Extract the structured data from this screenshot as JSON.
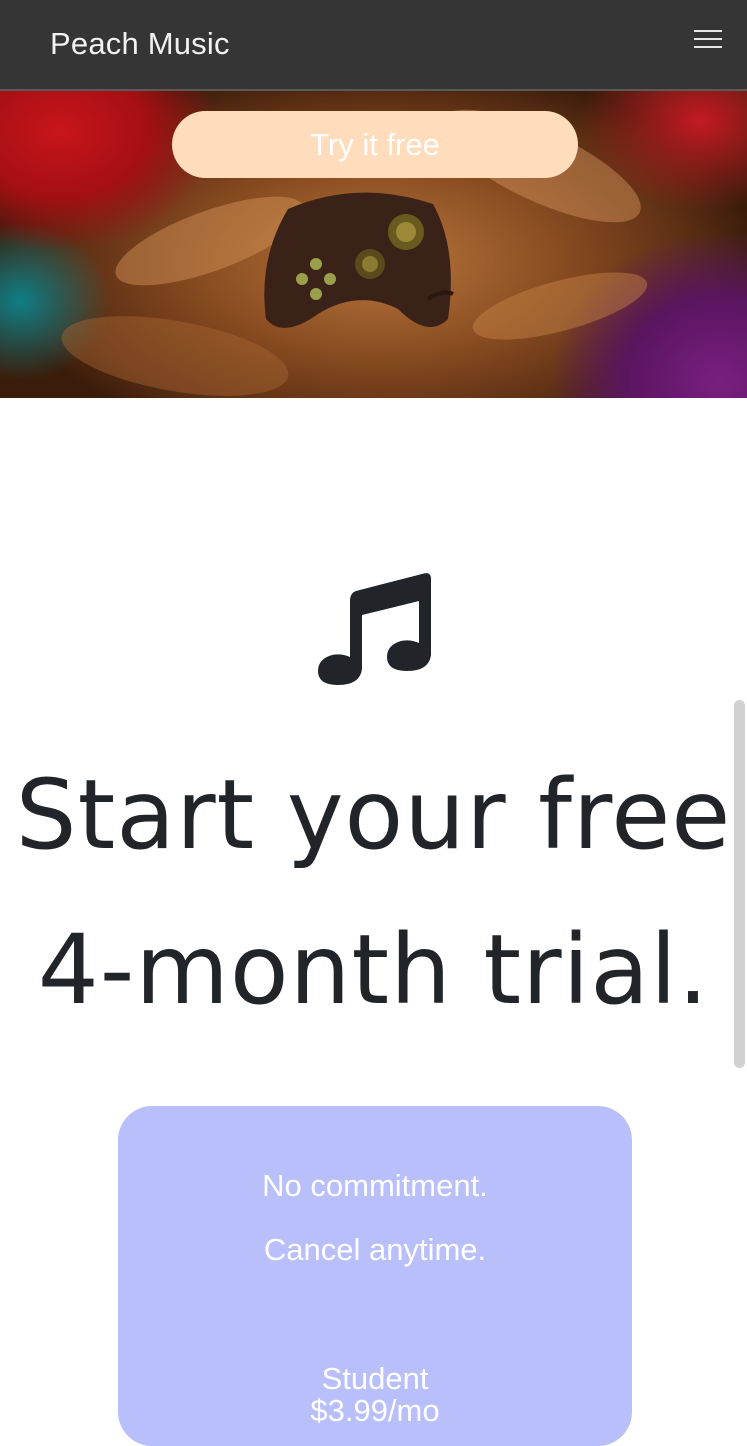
{
  "navbar": {
    "brand": "Peach Music",
    "menu_icon": "hamburger-menu-icon"
  },
  "hero": {
    "cta_label": "Try it free"
  },
  "main": {
    "icon": "music-note-icon",
    "headline_line1": "Start your free",
    "headline_line2": "4-month trial."
  },
  "plan_card": {
    "line1": "No commitment.",
    "line2": "Cancel anytime.",
    "plan_name": "Student",
    "plan_price": "$3.99/mo"
  },
  "colors": {
    "navbar_bg": "#353535",
    "cta_bg": "#ffdcbc",
    "card_bg": "#b8bffa",
    "text_dark": "#212529"
  }
}
